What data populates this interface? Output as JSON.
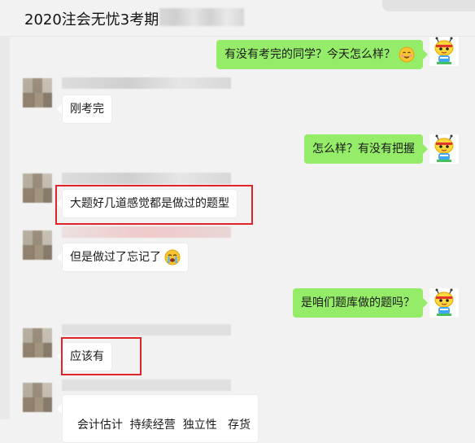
{
  "window": {
    "title": "2020注会无忧3考期"
  },
  "messages": [
    {
      "side": "right",
      "text": "有没有考完的同学？今天怎么样？",
      "emoji": "smiling-face-emoji"
    },
    {
      "side": "left",
      "text": "刚考完"
    },
    {
      "side": "right",
      "text": "怎么样？有没有把握"
    },
    {
      "side": "left",
      "text": "大题好几道感觉都是做过的题型",
      "highlighted": true
    },
    {
      "side": "left",
      "text": "但是做过了忘记了",
      "emoji": "crying-face-emoji"
    },
    {
      "side": "right",
      "text": "是咱们题库做的题吗？"
    },
    {
      "side": "left",
      "text": "应该有",
      "highlighted": true
    },
    {
      "side": "left",
      "text": "会计估计  持续经营  独立性   存货"
    }
  ],
  "colors": {
    "background": "#f2f2f2",
    "bubble_self": "#95ec69",
    "bubble_other": "#ffffff",
    "highlight_border": "#e0252a"
  }
}
